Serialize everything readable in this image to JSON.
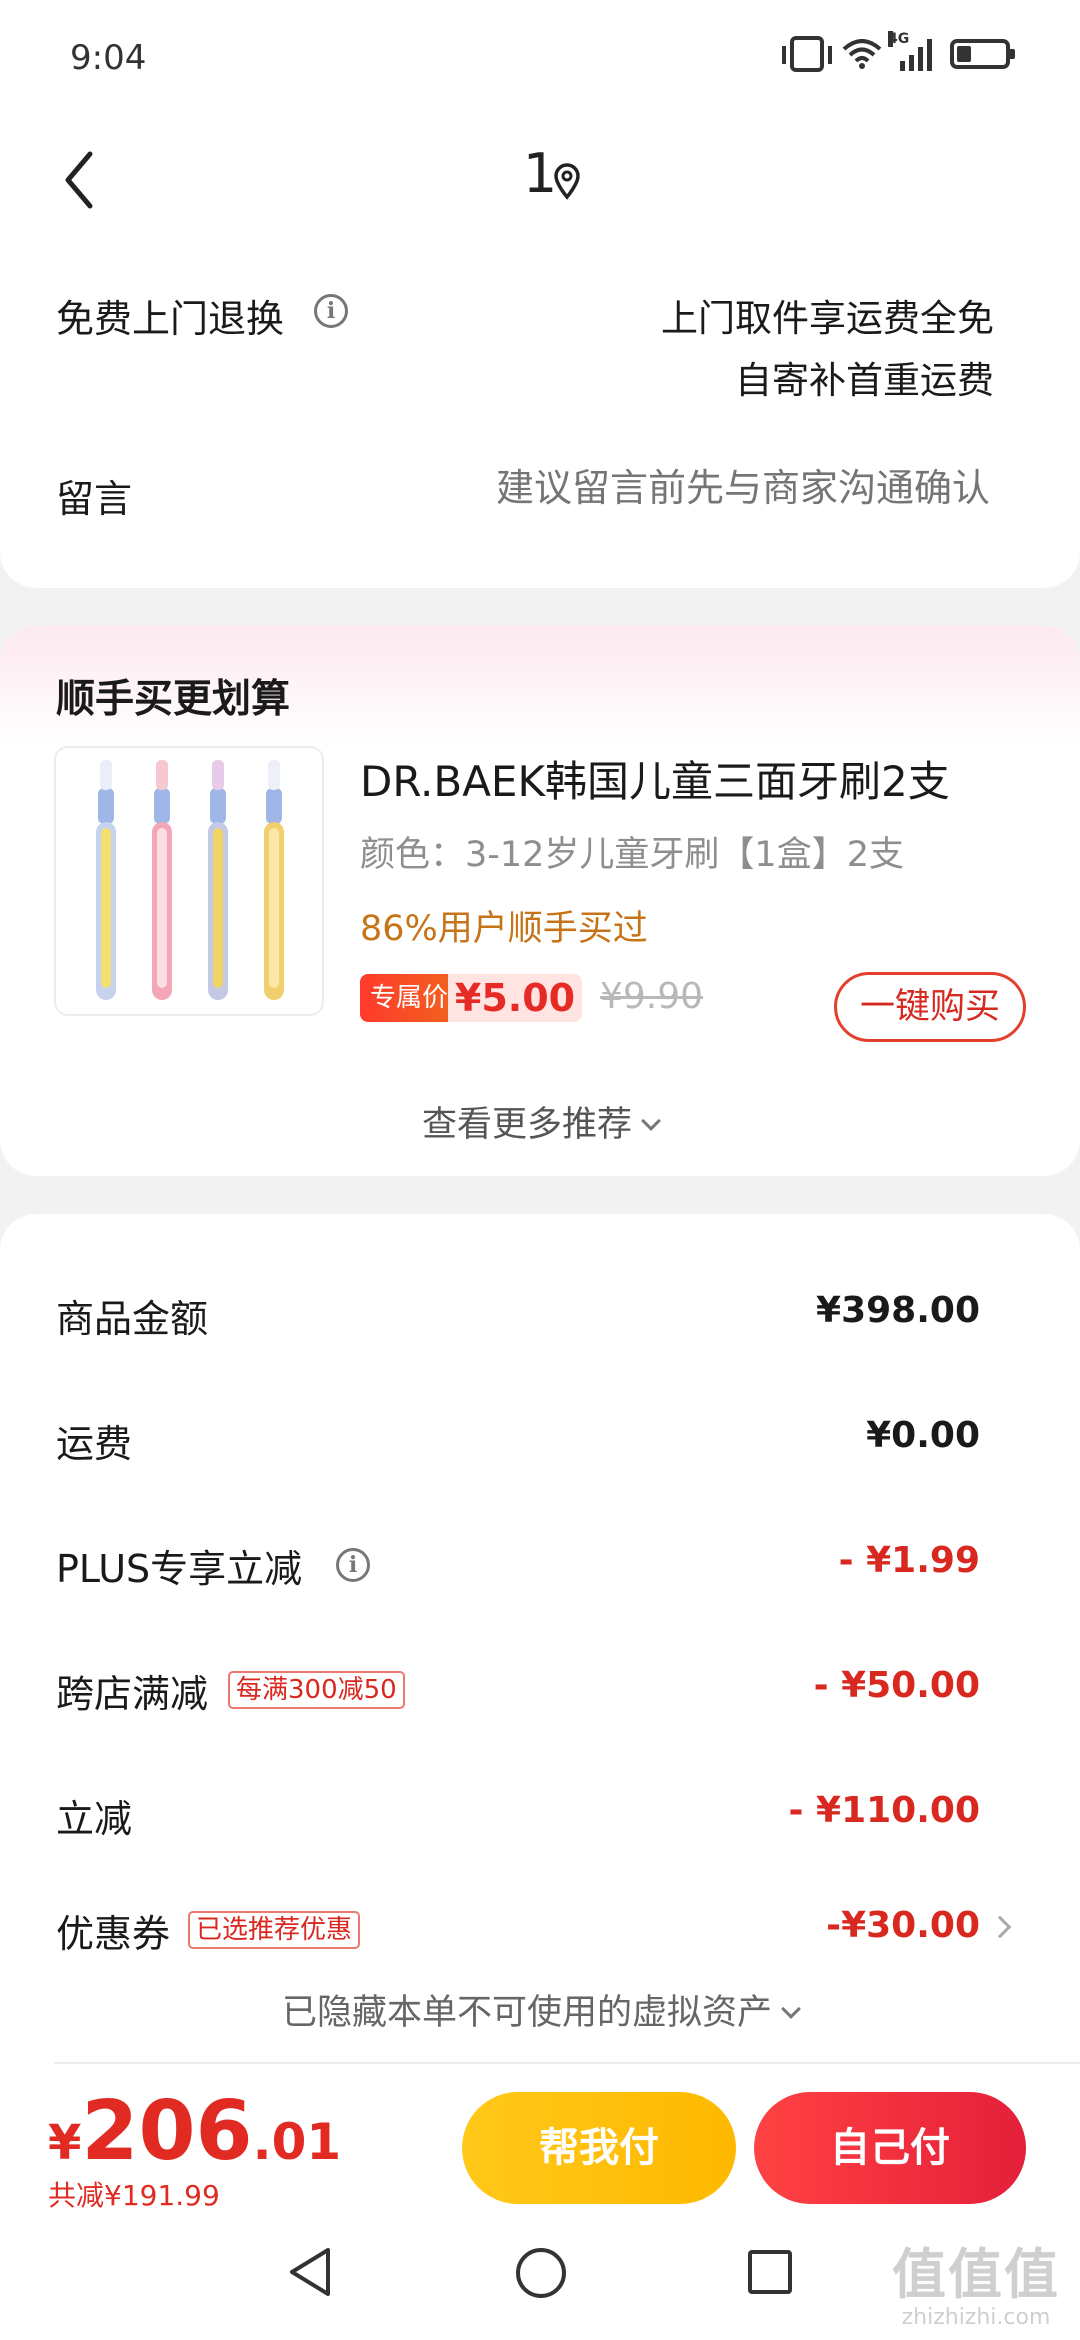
{
  "status_bar": {
    "time": "9:04",
    "network": "4G",
    "battery": "low"
  },
  "header": {
    "title": "1",
    "location_icon": "location-pin-icon",
    "back_icon": "chevron-left-icon"
  },
  "service": {
    "free_return_label": "免费上门退换",
    "free_return_line1": "上门取件享运费全免",
    "free_return_line2": "自寄补首重运费",
    "message_label": "留言",
    "message_placeholder": "建议留言前先与商家沟通确认"
  },
  "recommend": {
    "title": "顺手买更划算",
    "product_name": "DR.BAEK韩国儿童三面牙刷2支",
    "product_spec": "颜色：3-12岁儿童牙刷【1盒】2支",
    "social_proof": "86%用户顺手买过",
    "price_badge": "专属价",
    "price": "¥5.00",
    "old_price": "¥9.90",
    "buy_button": "一键购买",
    "more": "查看更多推荐",
    "toothbrush_colors": [
      "#f4e070",
      "#f2a6b6",
      "#f0d468",
      "#f2cf6e"
    ]
  },
  "fees": {
    "items": [
      {
        "label": "商品金额",
        "value": "¥398.00"
      },
      {
        "label": "运费",
        "value": "¥0.00"
      },
      {
        "label": "PLUS专享立减",
        "value": "- ¥1.99"
      },
      {
        "label": "跨店满减",
        "tag": "每满300减50",
        "value": "- ¥50.00"
      },
      {
        "label": "立减",
        "value": "- ¥110.00"
      },
      {
        "label": "优惠券",
        "tag": "已选推荐优惠",
        "value": "-¥30.00"
      }
    ],
    "hidden_assets": "已隐藏本单不可使用的虚拟资产"
  },
  "footer": {
    "currency": "¥",
    "total_int": "206",
    "total_dec": ".01",
    "saved": "共减¥191.99",
    "help_pay": "帮我付",
    "self_pay": "自己付"
  },
  "watermark": {
    "logo": "值值值",
    "url": "zhizhizhi.com"
  },
  "colors": {
    "accent_red": "#e02a22",
    "help_pay_yellow": "#ffc81a",
    "discount_red": "#d9281f",
    "social_orange": "#c67418"
  }
}
